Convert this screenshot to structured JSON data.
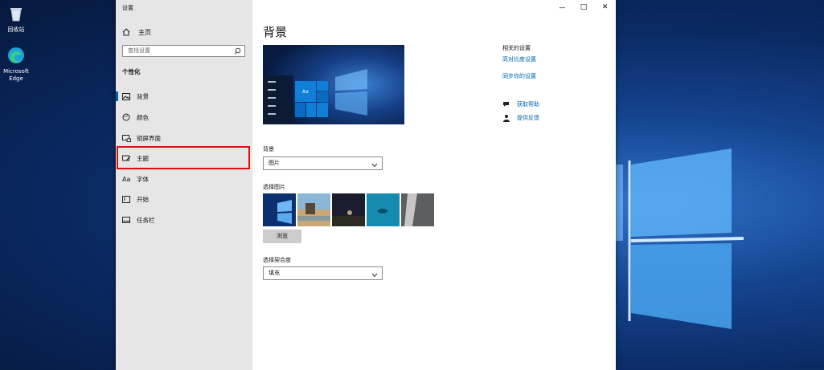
{
  "desktop": {
    "icons": [
      {
        "label": "回收站"
      },
      {
        "label": "Microsoft Edge"
      }
    ]
  },
  "window": {
    "title": "设置",
    "controls": {
      "minimize": "—",
      "maximize": "□",
      "close": "✕"
    }
  },
  "sidebar": {
    "home": "主页",
    "search_placeholder": "查找设置",
    "section": "个性化",
    "items": [
      {
        "label": "背景",
        "icon": "picture-icon",
        "active": true
      },
      {
        "label": "颜色",
        "icon": "palette-icon",
        "active": false
      },
      {
        "label": "锁屏界面",
        "icon": "lockscreen-icon",
        "active": false
      },
      {
        "label": "主题",
        "icon": "theme-icon",
        "active": false,
        "highlighted": true
      },
      {
        "label": "字体",
        "icon": "font-icon",
        "active": false
      },
      {
        "label": "开始",
        "icon": "start-icon",
        "active": false
      },
      {
        "label": "任务栏",
        "icon": "taskbar-icon",
        "active": false
      }
    ]
  },
  "main": {
    "title": "背景",
    "preview_tile_text": "Aa",
    "background_label": "背景",
    "background_value": "图片",
    "choose_picture_label": "选择图片",
    "browse_button": "浏览",
    "fit_label": "选择契合度",
    "fit_value": "填充"
  },
  "related": {
    "title": "相关的设置",
    "links": [
      "高对比度设置",
      "同步你的设置"
    ],
    "help": "获取帮助",
    "feedback": "提供反馈"
  },
  "colors": {
    "accent": "#0063b1",
    "link": "#0066b4",
    "highlight_border": "#e01010"
  }
}
